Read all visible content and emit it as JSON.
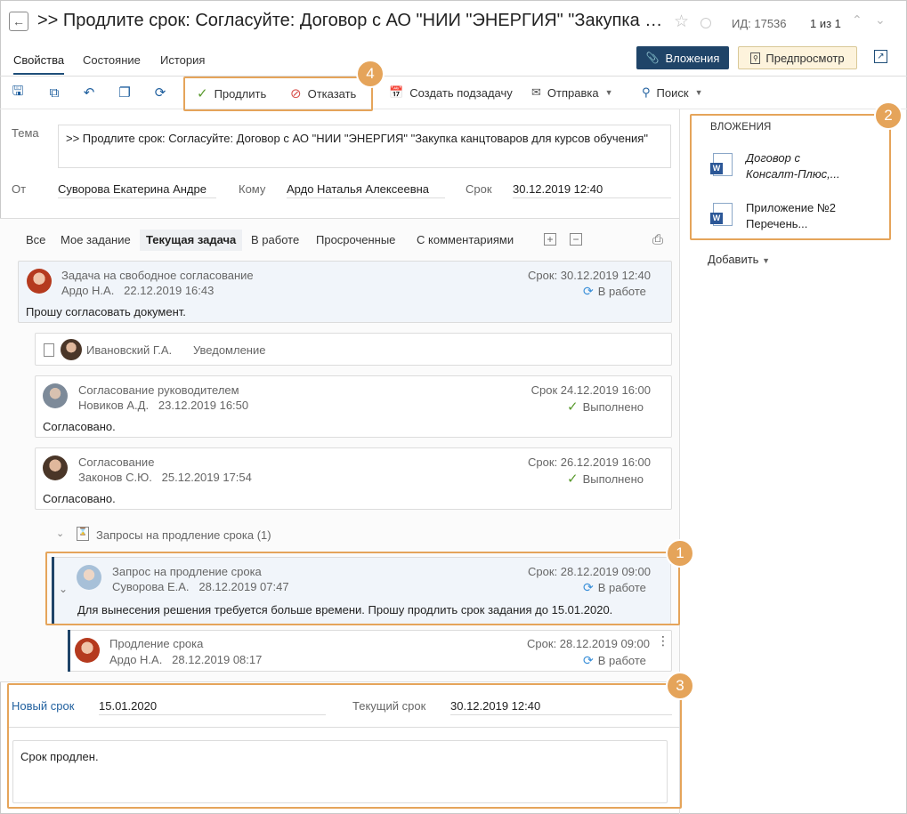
{
  "header": {
    "title": ">> Продлите срок: Согласуйте: Договор с АО \"НИИ \"ЭНЕРГИЯ\" \"Закупка ка...",
    "id_text": "ИД: 17536",
    "pager": "1 из 1"
  },
  "tabs": [
    "Свойства",
    "Состояние",
    "История"
  ],
  "header_buttons": {
    "attachments": "Вложения",
    "preview": "Предпросмотр"
  },
  "toolbar": {
    "extend": "Продлить",
    "refuse": "Отказать",
    "create_subtask": "Создать подзадачу",
    "send": "Отправка",
    "search": "Поиск"
  },
  "properties": {
    "tema_label": "Тема",
    "tema_value": ">> Продлите срок: Согласуйте: Договор с АО \"НИИ \"ЭНЕРГИЯ\" \"Закупка канцтоваров для курсов обучения\"",
    "from_label": "От",
    "from_value": "Суворова Екатерина Андре",
    "to_label": "Кому",
    "to_value": "Ардо Наталья Алексеевна",
    "deadline_label": "Срок",
    "deadline_value": "30.12.2019 12:40"
  },
  "filter_tabs": [
    "Все",
    "Мое задание",
    "Текущая задача",
    "В работе",
    "Просроченные",
    "С комментариями"
  ],
  "cards": {
    "c1": {
      "title": "Задача на свободное согласование",
      "author": "Ардо Н.А.",
      "date": "22.12.2019 16:43",
      "deadline": "Срок: 30.12.2019 12:40",
      "status": "В работе",
      "body": "Прошу согласовать документ."
    },
    "c2": {
      "name": "Ивановский Г.А.",
      "type": "Уведомление"
    },
    "c3": {
      "title": "Согласование руководителем",
      "author": "Новиков А.Д.",
      "date": "23.12.2019 16:50",
      "deadline": "Срок 24.12.2019 16:00",
      "status": "Выполнено",
      "body": "Согласовано."
    },
    "c4": {
      "title": "Согласование",
      "author": "Законов С.Ю.",
      "date": "25.12.2019 17:54",
      "deadline": "Срок: 26.12.2019 16:00",
      "status": "Выполнено",
      "body": "Согласовано."
    },
    "group": "Запросы на продление срока (1)",
    "c5": {
      "title": "Запрос на продление срока",
      "author": "Суворова Е.А.",
      "date": "28.12.2019 07:47",
      "deadline": "Срок: 28.12.2019 09:00",
      "status": "В работе",
      "body": "Для вынесения решения требуется больше времени. Прошу продлить срок задания до 15.01.2020."
    },
    "c6": {
      "title": "Продление срока",
      "author": "Ардо Н.А.",
      "date": "28.12.2019 08:17",
      "deadline": "Срок: 28.12.2019 09:00",
      "status": "В работе"
    }
  },
  "attachments": {
    "title": "ВЛОЖЕНИЯ",
    "items": [
      {
        "line1": "Договор с",
        "line2": "Консалт-Плюс,..."
      },
      {
        "line1": "Приложение №2",
        "line2": "Перечень..."
      }
    ],
    "add": "Добавить"
  },
  "bottom": {
    "new_deadline_label": "Новый срок",
    "new_deadline_value": "15.01.2020",
    "current_deadline_label": "Текущий срок",
    "current_deadline_value": "30.12.2019 12:40",
    "comment": "Срок продлен."
  },
  "badges": [
    "1",
    "2",
    "3",
    "4"
  ],
  "colors": {
    "accent": "#1f4468",
    "highlight": "#e5a45a",
    "done": "#5a9a2e",
    "in_progress": "#3a8fd8"
  }
}
